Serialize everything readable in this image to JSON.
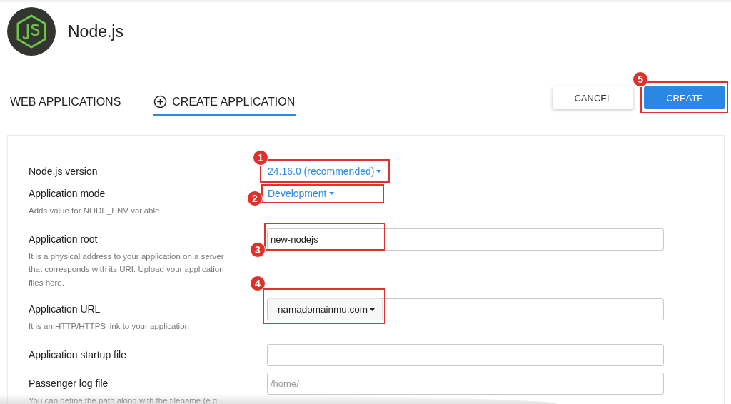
{
  "header": {
    "title": "Node.js"
  },
  "tabs": [
    {
      "label": "WEB APPLICATIONS",
      "selected": false,
      "icon": false
    },
    {
      "label": "CREATE APPLICATION",
      "selected": true,
      "icon": true
    }
  ],
  "actions": [
    {
      "label": "CANCEL",
      "kind": "secondary"
    },
    {
      "label": "CREATE",
      "kind": "primary",
      "annotation": "5"
    }
  ],
  "form": [
    {
      "label": "Node.js version",
      "kind": "dropdown-link",
      "value": "24.16.0 (recommended)",
      "annotation": "1"
    },
    {
      "label": "Application mode",
      "hint": "Adds value for NODE_ENV variable",
      "kind": "dropdown-link",
      "value": "Development",
      "annotation": "2"
    },
    {
      "label": "Application root",
      "hint": "It is a physical address to your application on a server that corresponds with its URI. Upload your application files here.",
      "kind": "text-input",
      "value": "new-nodejs",
      "annotation": "3"
    },
    {
      "label": "Application URL",
      "hint": "It is an HTTP/HTTPS link to your application",
      "kind": "select-input",
      "value": "namadomainmu.com",
      "annotation": "4"
    },
    {
      "label": "Application startup file",
      "kind": "text-input"
    },
    {
      "label": "Passenger log file",
      "hint": "You can define the path along with the filename (e.g.",
      "kind": "text-input",
      "placeholder": "/home/"
    }
  ]
}
